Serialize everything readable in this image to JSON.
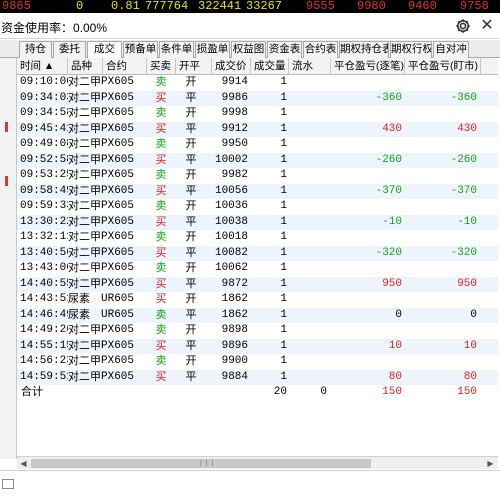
{
  "ticker": [
    "9865",
    "0",
    "0.81",
    "777764",
    "322441",
    "33267",
    "9555",
    "9980",
    "9460",
    "9758"
  ],
  "account": {
    "usage_label": "资金使用率：0.00%"
  },
  "tabs": [
    "持仓",
    "委托",
    "成交",
    "预备单",
    "条件单",
    "损盈单",
    "权益图",
    "资金表",
    "合约表",
    "期权持仓表",
    "期权行权",
    "自对冲"
  ],
  "active_tab": "成交",
  "table": {
    "headers": [
      "时间 ▲",
      "品种",
      "合约",
      "买卖",
      "开平",
      "成交价",
      "成交量",
      "流水",
      "平仓盈亏(逐笔)",
      "平仓盈亏(盯市)"
    ],
    "rows": [
      {
        "time": "09:10:00",
        "product": "对二甲",
        "contract": "PX605",
        "side": "卖",
        "oc": "开",
        "price": "9914",
        "qty": "1",
        "serial": "",
        "pnl_trade": "",
        "pnl_mark": ""
      },
      {
        "time": "09:34:03",
        "product": "对二甲",
        "contract": "PX605",
        "side": "买",
        "oc": "平",
        "price": "9986",
        "qty": "1",
        "serial": "",
        "pnl_trade": "-360",
        "pnl_mark": "-360"
      },
      {
        "time": "09:34:58",
        "product": "对二甲",
        "contract": "PX605",
        "side": "卖",
        "oc": "开",
        "price": "9998",
        "qty": "1",
        "serial": "",
        "pnl_trade": "",
        "pnl_mark": ""
      },
      {
        "time": "09:45:41",
        "product": "对二甲",
        "contract": "PX605",
        "side": "买",
        "oc": "平",
        "price": "9912",
        "qty": "1",
        "serial": "",
        "pnl_trade": "430",
        "pnl_mark": "430"
      },
      {
        "time": "09:49:08",
        "product": "对二甲",
        "contract": "PX605",
        "side": "卖",
        "oc": "开",
        "price": "9950",
        "qty": "1",
        "serial": "",
        "pnl_trade": "",
        "pnl_mark": ""
      },
      {
        "time": "09:52:58",
        "product": "对二甲",
        "contract": "PX605",
        "side": "买",
        "oc": "平",
        "price": "10002",
        "qty": "1",
        "serial": "",
        "pnl_trade": "-260",
        "pnl_mark": "-260"
      },
      {
        "time": "09:53:25",
        "product": "对二甲",
        "contract": "PX605",
        "side": "卖",
        "oc": "开",
        "price": "9982",
        "qty": "1",
        "serial": "",
        "pnl_trade": "",
        "pnl_mark": ""
      },
      {
        "time": "09:58:49",
        "product": "对二甲",
        "contract": "PX605",
        "side": "买",
        "oc": "平",
        "price": "10056",
        "qty": "1",
        "serial": "",
        "pnl_trade": "-370",
        "pnl_mark": "-370"
      },
      {
        "time": "09:59:33",
        "product": "对二甲",
        "contract": "PX605",
        "side": "卖",
        "oc": "开",
        "price": "10036",
        "qty": "1",
        "serial": "",
        "pnl_trade": "",
        "pnl_mark": ""
      },
      {
        "time": "13:30:22",
        "product": "对二甲",
        "contract": "PX605",
        "side": "买",
        "oc": "平",
        "price": "10038",
        "qty": "1",
        "serial": "",
        "pnl_trade": "-10",
        "pnl_mark": "-10"
      },
      {
        "time": "13:32:11",
        "product": "对二甲",
        "contract": "PX605",
        "side": "卖",
        "oc": "开",
        "price": "10018",
        "qty": "1",
        "serial": "",
        "pnl_trade": "",
        "pnl_mark": ""
      },
      {
        "time": "13:40:56",
        "product": "对二甲",
        "contract": "PX605",
        "side": "买",
        "oc": "平",
        "price": "10082",
        "qty": "1",
        "serial": "",
        "pnl_trade": "-320",
        "pnl_mark": "-320"
      },
      {
        "time": "13:43:06",
        "product": "对二甲",
        "contract": "PX605",
        "side": "卖",
        "oc": "开",
        "price": "10062",
        "qty": "1",
        "serial": "",
        "pnl_trade": "",
        "pnl_mark": ""
      },
      {
        "time": "14:40:55",
        "product": "对二甲",
        "contract": "PX605",
        "side": "买",
        "oc": "平",
        "price": "9872",
        "qty": "1",
        "serial": "",
        "pnl_trade": "950",
        "pnl_mark": "950"
      },
      {
        "time": "14:43:51",
        "product": "尿素",
        "contract": "UR605",
        "side": "买",
        "oc": "开",
        "price": "1862",
        "qty": "1",
        "serial": "",
        "pnl_trade": "",
        "pnl_mark": ""
      },
      {
        "time": "14:46:49",
        "product": "尿素",
        "contract": "UR605",
        "side": "卖",
        "oc": "平",
        "price": "1862",
        "qty": "1",
        "serial": "",
        "pnl_trade": "0",
        "pnl_mark": "0"
      },
      {
        "time": "14:49:26",
        "product": "对二甲",
        "contract": "PX605",
        "side": "卖",
        "oc": "开",
        "price": "9898",
        "qty": "1",
        "serial": "",
        "pnl_trade": "",
        "pnl_mark": ""
      },
      {
        "time": "14:55:15",
        "product": "对二甲",
        "contract": "PX605",
        "side": "买",
        "oc": "平",
        "price": "9896",
        "qty": "1",
        "serial": "",
        "pnl_trade": "10",
        "pnl_mark": "10"
      },
      {
        "time": "14:56:23",
        "product": "对二甲",
        "contract": "PX605",
        "side": "卖",
        "oc": "开",
        "price": "9900",
        "qty": "1",
        "serial": "",
        "pnl_trade": "",
        "pnl_mark": ""
      },
      {
        "time": "14:59:51",
        "product": "对二甲",
        "contract": "PX605",
        "side": "买",
        "oc": "平",
        "price": "9884",
        "qty": "1",
        "serial": "",
        "pnl_trade": "80",
        "pnl_mark": "80"
      }
    ],
    "total": {
      "label": "合计",
      "qty": "20",
      "serial": "0",
      "pnl_trade": "150",
      "pnl_mark": "150"
    }
  },
  "colors": {
    "buy": "#e02020",
    "sell": "#13a313",
    "row_alt": "#eef4fb",
    "ticker_red": "#e03030",
    "ticker_yellow": "#e8e800"
  },
  "icons": {
    "settings": "gear-icon",
    "close": "close-icon",
    "scroll_left": "arrow-left-icon",
    "scroll_right": "arrow-right-icon"
  }
}
